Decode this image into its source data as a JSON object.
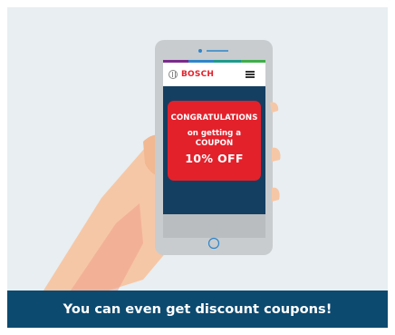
{
  "phone": {
    "brand_name": "BOSCH",
    "brand_icon": "bosch-logo-icon",
    "menu_icon": "hamburger-menu-icon"
  },
  "coupon": {
    "line1": "CONGRATULATIONS",
    "line2": "on getting a",
    "line3": "COUPON",
    "line4": "10% OFF"
  },
  "banner": {
    "text": "You can even get discount coupons!"
  },
  "colors": {
    "background": "#e8eef1",
    "coupon_red": "#e3212b",
    "screen_navy": "#153f61",
    "banner_navy": "#0c4a70",
    "skin": "#f6c7a6"
  }
}
